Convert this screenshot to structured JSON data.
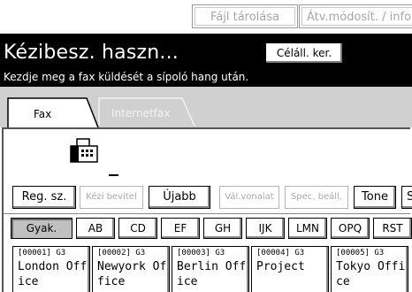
{
  "top_buttons": {
    "file_storage": "Fájl tárolása",
    "transfer_settings": "Átv.módosít. / info"
  },
  "header": {
    "title": "Kézibesz. haszn...",
    "subtitle": "Kezdje meg a fax küldését a sípoló hang után.",
    "dest_search_button": "Céláll. ker."
  },
  "tabs": [
    {
      "label": "Fax",
      "active": true
    },
    {
      "label": "Internetfax",
      "active": false
    }
  ],
  "fax_icon": "fax-machine-icon",
  "command_buttons": {
    "reg_no": "Reg. sz.",
    "manual_entry": "Kézi bevitel",
    "new": "Újabb",
    "line_select": "Vál.vonalat",
    "special_sender": "Spec. beáll.",
    "tone": "Tone",
    "cut_off": "S"
  },
  "index_tabs": [
    "Gyak.",
    "AB",
    "CD",
    "EF",
    "GH",
    "IJK",
    "LMN",
    "OPQ",
    "RST"
  ],
  "selected_index": "Gyak.",
  "destinations": [
    {
      "reg": "[00001] G3",
      "name": "London Office"
    },
    {
      "reg": "[00002] G3",
      "name": "Newyork Office"
    },
    {
      "reg": "[00003] G3",
      "name": "Berlin Office"
    },
    {
      "reg": "[00004] G3",
      "name": "Project"
    },
    {
      "reg": "[00005] G3",
      "name": "Tokyo Office"
    }
  ],
  "colors": {
    "header_bg": "#000000",
    "tab_row_bg": "#d0d0d0",
    "disabled_text": "#a8a8a8",
    "selected_index_bg": "#c0c0c0"
  }
}
